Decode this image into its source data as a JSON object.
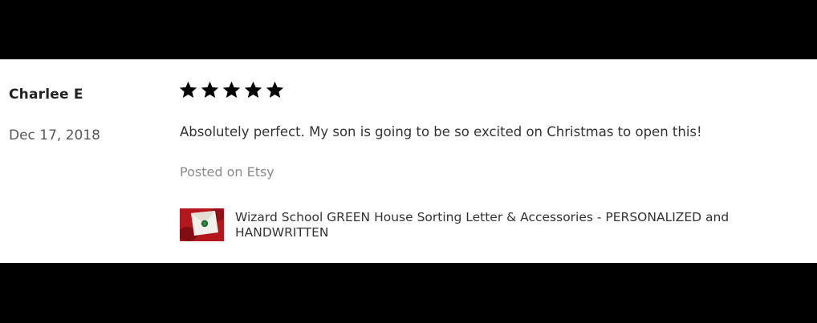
{
  "review": {
    "reviewer_name": "Charlee E",
    "date": "Dec 17, 2018",
    "rating": 5,
    "rating_max": 5,
    "text": "Absolutely perfect. My son is going to be so excited on Christmas to open this!",
    "source": "Posted on Etsy",
    "product": {
      "title": "Wizard School GREEN House Sorting Letter & Accessories - PERSONALIZED and HANDWRITTEN",
      "thumbnail": "product-thumbnail"
    }
  },
  "colors": {
    "background_bars": "#000000",
    "card": "#ffffff",
    "star": "#000000",
    "name_text": "#222222",
    "muted_text": "#8a8a8a",
    "thumbnail_red": "#b3161e"
  },
  "icons": [
    "star-icon",
    "product-thumbnail"
  ]
}
